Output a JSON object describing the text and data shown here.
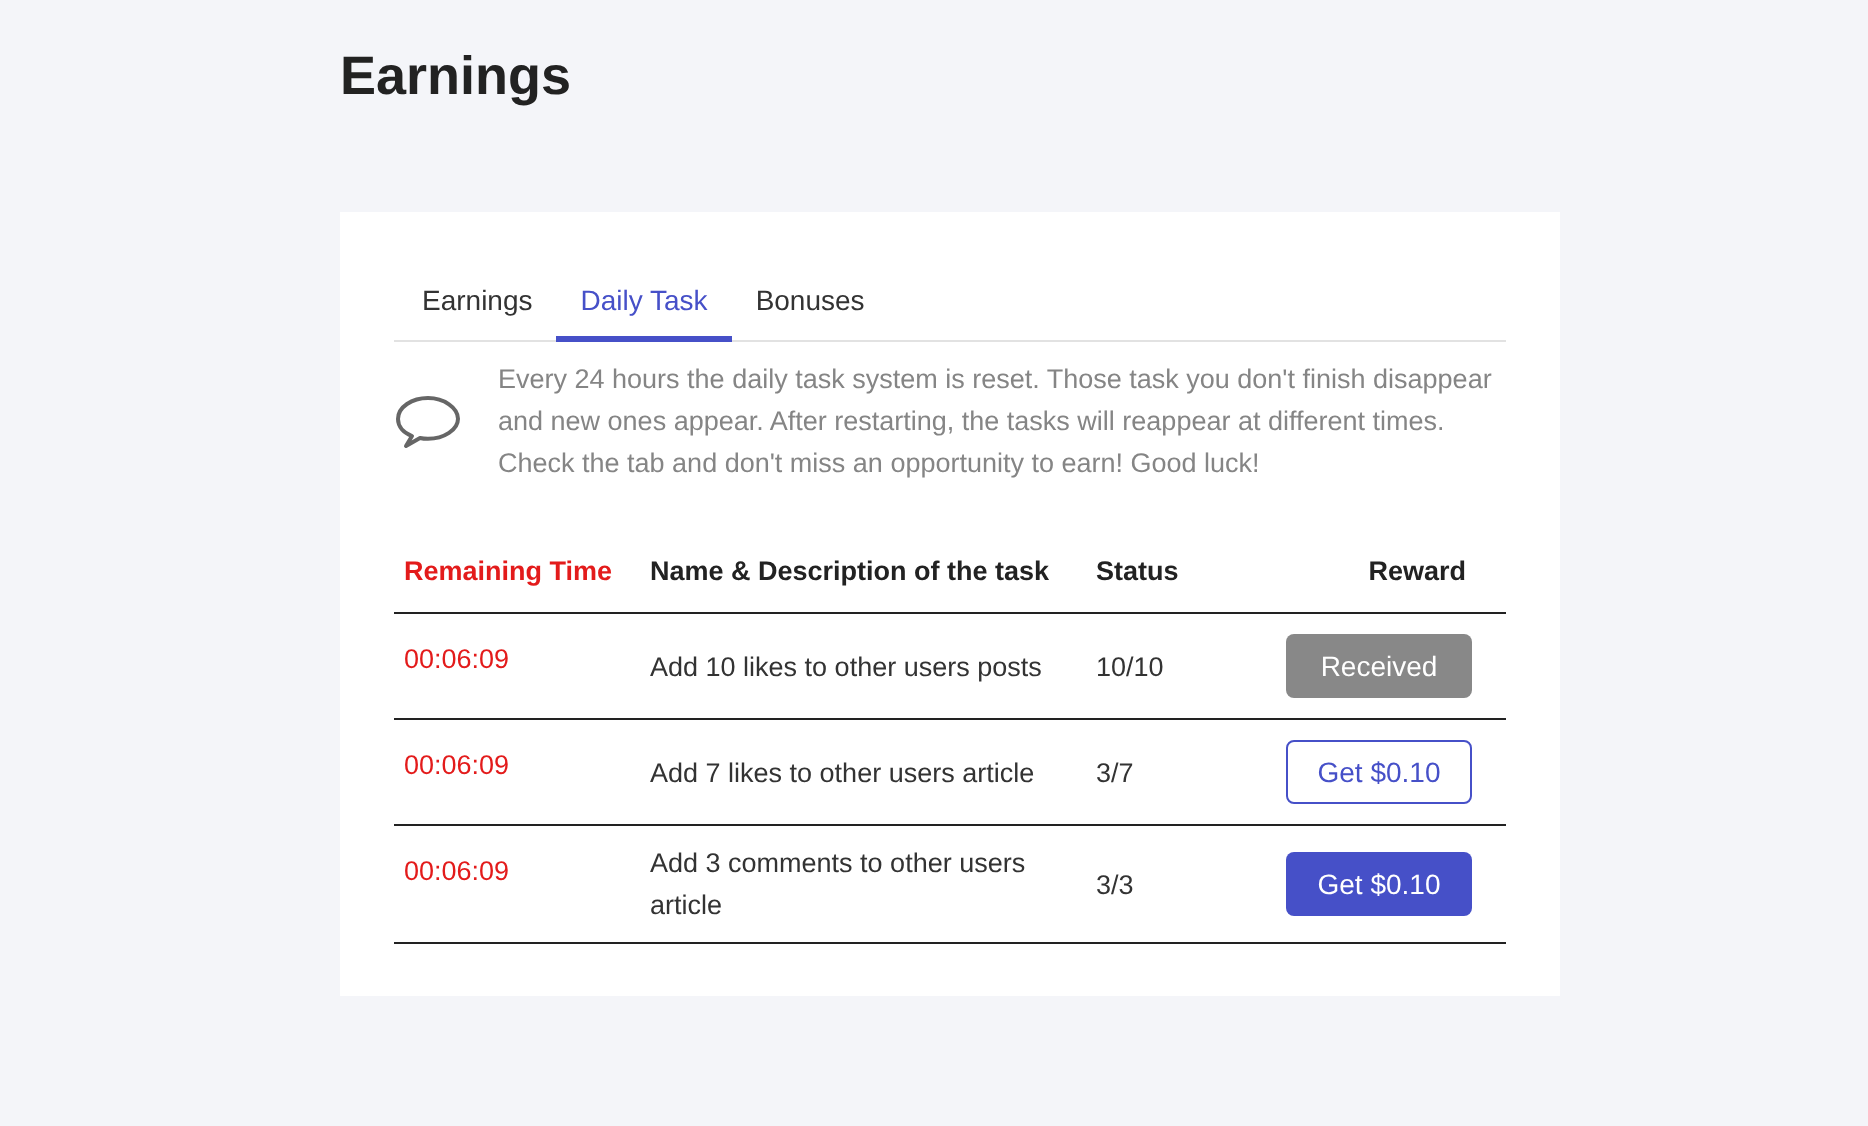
{
  "page_title": "Earnings",
  "tabs": [
    {
      "label": "Earnings",
      "selected": false
    },
    {
      "label": "Daily Task",
      "selected": true
    },
    {
      "label": "Bonuses",
      "selected": false
    }
  ],
  "notice": "Every 24 hours the daily task system is reset. Those task you don't finish disappear and new ones appear. After restarting, the tasks will reappear at different times. Check the tab and don't miss an opportunity to earn! Good luck!",
  "table": {
    "columns": [
      "Remaining Time",
      "Name & Description of the task",
      "Status",
      "Reward"
    ],
    "rows": [
      {
        "time": "00:06:09",
        "task": "Add 10 likes to other users posts",
        "status": "10/10",
        "reward": {
          "label": "Received",
          "kind": "received"
        }
      },
      {
        "time": "00:06:09",
        "task": "Add 7 likes to other users article",
        "status": "3/7",
        "reward": {
          "label": "Get $0.10",
          "kind": "outline"
        }
      },
      {
        "time": "00:06:09",
        "task": "Add 3 comments to other users article",
        "status": "3/3",
        "reward": {
          "label": "Get $0.10",
          "kind": "filled"
        }
      }
    ]
  }
}
